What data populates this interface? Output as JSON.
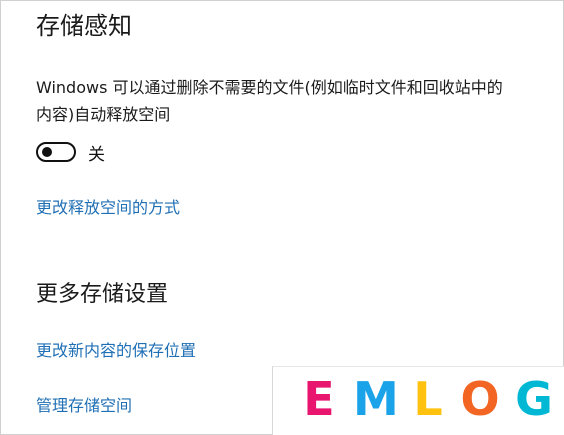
{
  "storage_sense": {
    "title": "存储感知",
    "description": "Windows 可以通过删除不需要的文件(例如临时文件和回收站中的内容)自动释放空间",
    "toggle_state": "关",
    "toggle_on": false,
    "link_change_free_space": "更改释放空间的方式"
  },
  "more_storage": {
    "title": "更多存储设置",
    "link_change_save_location": "更改新内容的保存位置",
    "link_manage_spaces": "管理存储空间"
  },
  "logo": {
    "text": "EMLOG",
    "letters": [
      "E",
      "M",
      "L",
      "O",
      "G"
    ],
    "colors": [
      "#e8166e",
      "#1aa3e8",
      "#ffc20e",
      "#f26522",
      "#00b8d4"
    ]
  },
  "colors": {
    "link": "#1f6fb5",
    "text": "#1a1a1a"
  }
}
